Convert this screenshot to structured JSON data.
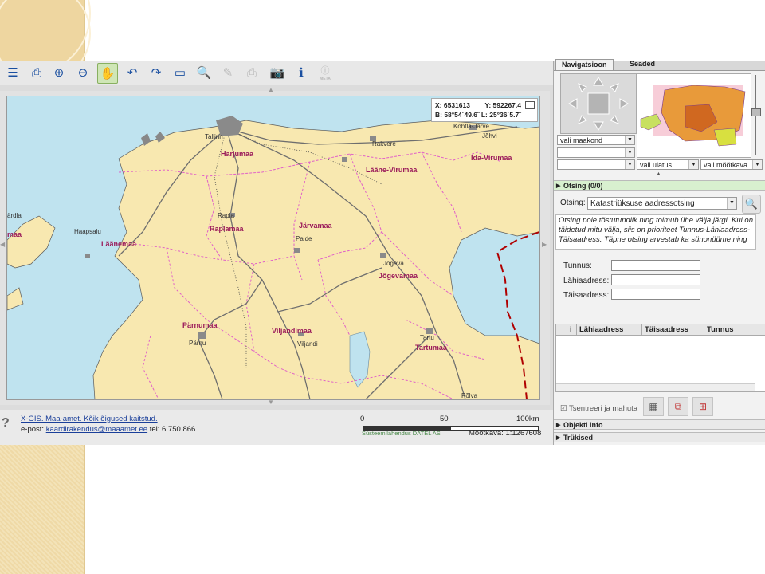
{
  "toolbar": {
    "tools": [
      {
        "name": "layers",
        "glyph": "☰"
      },
      {
        "name": "print-preview",
        "glyph": "⎙"
      },
      {
        "name": "zoom-in",
        "glyph": "⊕"
      },
      {
        "name": "zoom-out",
        "glyph": "⊖"
      },
      {
        "name": "pan",
        "glyph": "✋"
      },
      {
        "name": "undo",
        "glyph": "↶"
      },
      {
        "name": "redo",
        "glyph": "↷"
      },
      {
        "name": "measure",
        "glyph": "▭"
      },
      {
        "name": "search",
        "glyph": "🔍"
      },
      {
        "name": "draw",
        "glyph": "✎"
      },
      {
        "name": "print",
        "glyph": "⎙"
      },
      {
        "name": "camera",
        "glyph": "📷"
      },
      {
        "name": "info",
        "glyph": "ℹ"
      },
      {
        "name": "meta",
        "glyph": "ⓘ",
        "label": "META"
      }
    ]
  },
  "map": {
    "coords": {
      "x": "X: 6531613",
      "y": "Y: 592267.4",
      "b": "B: 58°54´49.6˝",
      "l": "L: 25°36´5.7˝"
    },
    "places": [
      "Kohtla-Järve",
      "Jõhvi",
      "Tallinn",
      "Rakvere",
      "Harjumaa",
      "Lääne-Virumaa",
      "Ida-Virumaa",
      "Rapla",
      "Raplamaa",
      "Järvamaa",
      "Haapsalu",
      "Läänemaa",
      "Paide",
      "Jõgeva",
      "Jõgevamaa",
      "Pärnumaa",
      "Pärnu",
      "Viljandimaa",
      "Viljandi",
      "Tartu",
      "Tartumaa",
      "Põlva",
      "ärdla",
      "maa"
    ]
  },
  "footer": {
    "help": "?",
    "line1_link": "X-GIS. Maa-amet. Kõik õigused kaitstud.",
    "line2_prefix": "e-post: ",
    "line2_link": "kaardirakendus@maaamet.ee",
    "line2_suffix": " tel: 6 750 866",
    "scale": {
      "l0": "0",
      "l50": "50",
      "l100": "100km"
    },
    "credit": "Süsteemilahendus DATEL AS",
    "mootkava": "Mõõtkava: 1:1267608"
  },
  "panel": {
    "tabs": [
      "Navigatsioon",
      "Seaded"
    ],
    "selects": {
      "maakond": "vali maakond",
      "blank1": "",
      "blank2": "",
      "ulatus": "vali ulatus",
      "mootkava": "vali mõõtkava"
    },
    "otsing_header": "Otsing (0/0)",
    "otsing_label": "Otsing:",
    "otsing_value": "Katastriüksuse aadressotsing",
    "info_text": "Otsing pole tõstutundlik ning toimub ühe välja järgi. Kui on täidetud mitu välja, siis on prioriteet Tunnus-Lähiaadress-Täisaadress. Täpne otsing arvestab ka sünonüüme ning",
    "fields": {
      "tunnus": "Tunnus:",
      "lahiaadress": "Lähiaadress:",
      "taisaadress": "Täisaadress:"
    },
    "table_headers": [
      "i",
      "Lähiaadress",
      "Täisaadress",
      "Tunnus"
    ],
    "tsentreeri": "Tsentreeri ja mahuta",
    "objekti_info": "Objekti info",
    "trukised": "Trükised"
  },
  "colors": {
    "land": "#f8e8b0",
    "sea": "#bfe3ef",
    "border": "#e060c8",
    "road": "#6e6e6e",
    "label": "#9a1a5a",
    "accent": "#7ac060"
  }
}
